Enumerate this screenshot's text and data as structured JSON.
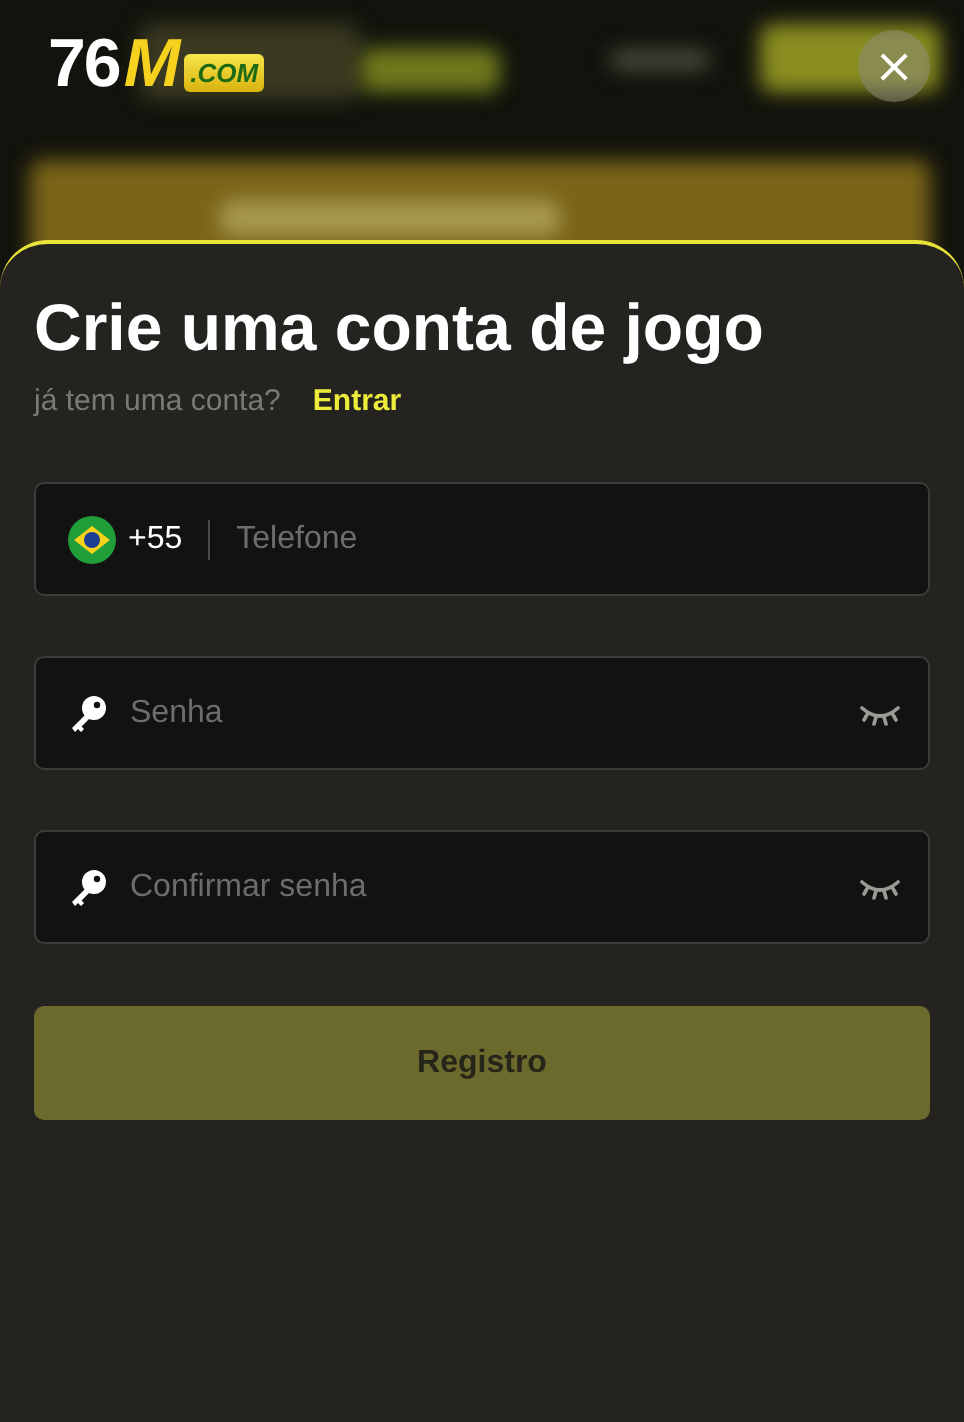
{
  "logo": {
    "number": "76",
    "letter": "M",
    "domain": ".COM"
  },
  "close_button": {
    "label": "×"
  },
  "form": {
    "title": "Crie uma conta de jogo",
    "prompt": "já tem uma conta?",
    "login_link": "Entrar",
    "fields": [
      {
        "kind": "phone",
        "dial_code": "+55",
        "placeholder": "Telefone"
      },
      {
        "kind": "password",
        "placeholder": "Senha"
      },
      {
        "kind": "password",
        "placeholder": "Confirmar senha"
      }
    ],
    "submit": {
      "label": "Registro",
      "disabled": true
    }
  }
}
